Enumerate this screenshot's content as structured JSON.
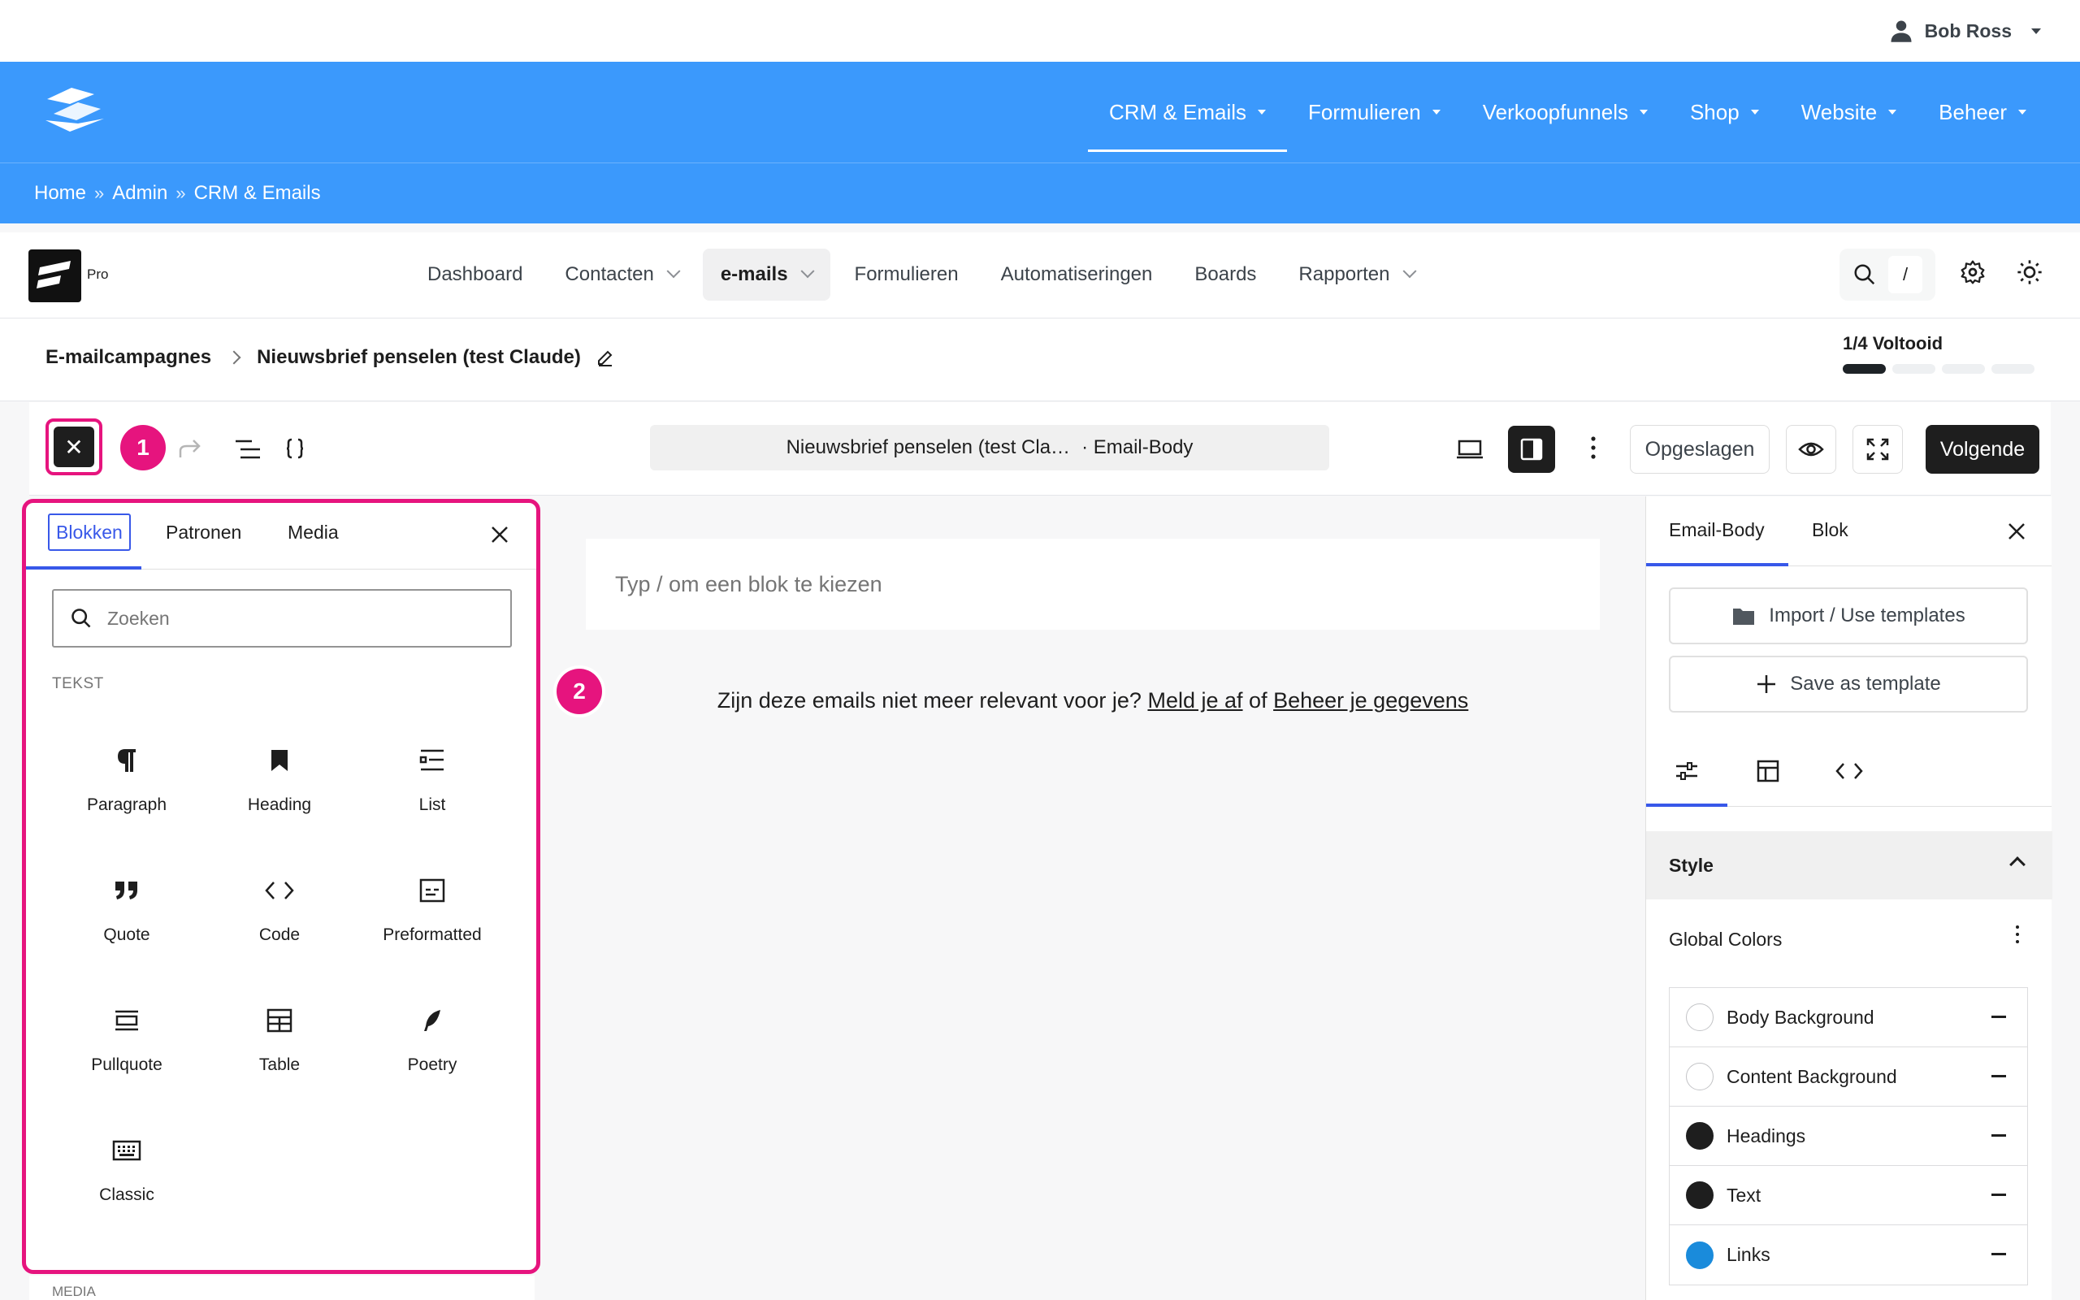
{
  "user": {
    "name": "Bob Ross"
  },
  "site_nav": {
    "items": [
      "CRM & Emails",
      "Formulieren",
      "Verkoopfunnels",
      "Shop",
      "Website",
      "Beheer"
    ],
    "active_index": 0
  },
  "breadcrumb": [
    "Home",
    "Admin",
    "CRM & Emails"
  ],
  "breadcrumb_sep": "»",
  "app": {
    "badge": "Pro",
    "nav": [
      "Dashboard",
      "Contacten",
      "e-mails",
      "Formulieren",
      "Automatiseringen",
      "Boards",
      "Rapporten"
    ],
    "nav_active_index": 2,
    "search_shortcut": "/"
  },
  "campaign": {
    "parent": "E-mailcampagnes",
    "title": "Nieuwsbrief penselen (test Claude)",
    "progress_label": "1/4 Voltooid",
    "progress_done": 1,
    "progress_total": 4
  },
  "toolbar": {
    "close_symbol": "✕",
    "step1": "1",
    "doc_title": "Nieuwsbrief penselen (test Cla…",
    "doc_context": "· Email-Body",
    "saved_label": "Opgeslagen",
    "next_label": "Volgende"
  },
  "inserter": {
    "tabs": [
      "Blokken",
      "Patronen",
      "Media"
    ],
    "search_placeholder": "Zoeken",
    "category": "TEKST",
    "blocks": [
      {
        "label": "Paragraph",
        "icon": "paragraph-icon"
      },
      {
        "label": "Heading",
        "icon": "heading-icon"
      },
      {
        "label": "List",
        "icon": "list-icon"
      },
      {
        "label": "Quote",
        "icon": "quote-icon"
      },
      {
        "label": "Code",
        "icon": "code-icon"
      },
      {
        "label": "Preformatted",
        "icon": "preformatted-icon"
      },
      {
        "label": "Pullquote",
        "icon": "pullquote-icon"
      },
      {
        "label": "Table",
        "icon": "table-icon"
      },
      {
        "label": "Poetry",
        "icon": "poetry-icon"
      },
      {
        "label": "Classic",
        "icon": "classic-icon"
      }
    ],
    "next_category": "MEDIA"
  },
  "canvas": {
    "placeholder": "Typ / om een blok te kiezen",
    "step2": "2",
    "footer_prefix": "Zijn deze emails niet meer relevant voor je?",
    "unsubscribe_link": "Meld je af",
    "footer_or": "of",
    "manage_link": "Beheer je gegevens"
  },
  "sidebar": {
    "tabs": [
      "Email-Body",
      "Blok"
    ],
    "import_label": "Import / Use templates",
    "save_label": "Save as template",
    "style_label": "Style",
    "global_colors_label": "Global Colors",
    "colors": [
      {
        "label": "Body Background",
        "color": "#ffffff"
      },
      {
        "label": "Content Background",
        "color": "#ffffff"
      },
      {
        "label": "Headings",
        "color": "#1e1e1e"
      },
      {
        "label": "Text",
        "color": "#1e1e1e"
      },
      {
        "label": "Links",
        "color": "#1a8bdb"
      }
    ]
  },
  "colors": {
    "brand_blue": "#3b99fc",
    "highlight_pink": "#e6147e",
    "accent_blue": "#3858e9",
    "dark": "#1e1e1e"
  }
}
